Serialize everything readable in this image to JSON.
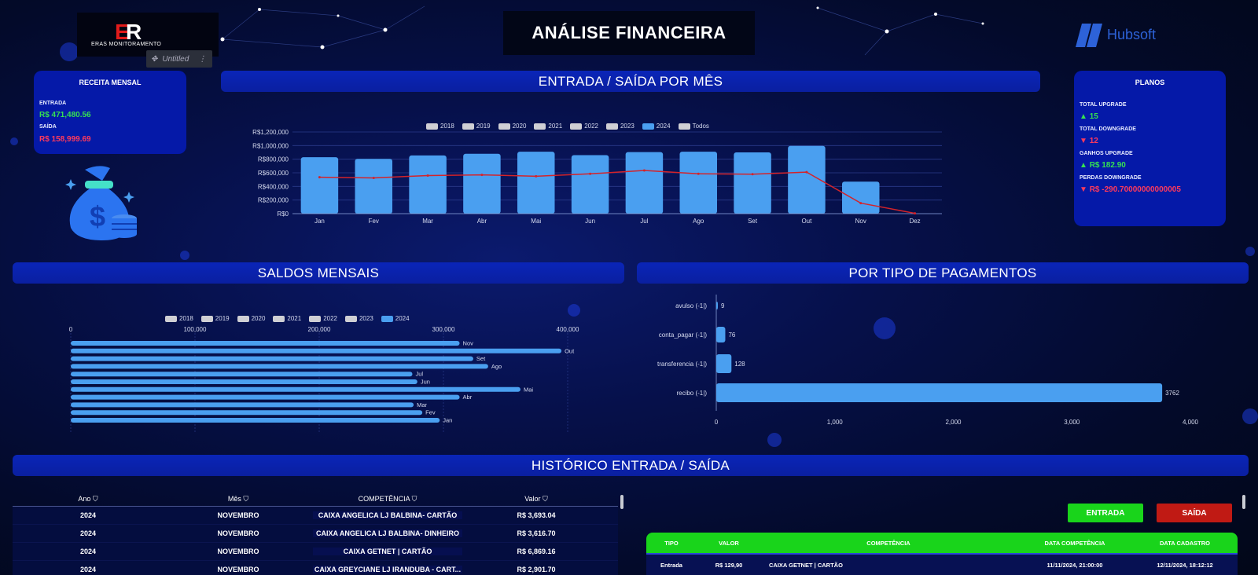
{
  "header": {
    "title": "ANÁLISE FINANCEIRA",
    "logo_left_text": "ERAS MONITORAMENTO",
    "logo_right_text": "Hubsoft",
    "untitled_label": "Untitled"
  },
  "receita": {
    "title": "RECEITA MENSAL",
    "entrada_label": "ENTRADA",
    "entrada_value": "R$ 471,480.56",
    "saida_label": "SAÍDA",
    "saida_value": "R$ 158,999.69"
  },
  "planos": {
    "title": "PLANOS",
    "upgrade_label": "TOTAL UPGRADE",
    "upgrade_value": "15",
    "downgrade_label": "TOTAL DOWNGRADE",
    "downgrade_value": "12",
    "ganhos_label": "GANHOS UPGRADE",
    "ganhos_value": "R$ 182.90",
    "perdas_label": "PERDAS DOWNGRADE",
    "perdas_value": "R$ -290.70000000000005"
  },
  "sections": {
    "entrada_saida": "ENTRADA / SAÍDA POR MÊS",
    "saldos": "SALDOS MENSAIS",
    "pagamentos": "POR TIPO DE PAGAMENTOS",
    "historico": "HISTÓRICO ENTRADA / SAÍDA"
  },
  "legend_top": [
    "2018",
    "2019",
    "2020",
    "2021",
    "2022",
    "2023",
    "2024",
    "Todos"
  ],
  "legend_top_active": "2024",
  "legend_saldos": [
    "2018",
    "2019",
    "2020",
    "2021",
    "2022",
    "2023",
    "2024"
  ],
  "legend_saldos_active": "2024",
  "colors": {
    "bar": "#4a9ff0",
    "line": "#d4232a",
    "green": "#19d41b",
    "red": "#c01a14"
  },
  "chart_data": [
    {
      "type": "bar",
      "title": "ENTRADA / SAÍDA POR MÊS",
      "categories": [
        "Jan",
        "Fev",
        "Mar",
        "Abr",
        "Mai",
        "Jun",
        "Jul",
        "Ago",
        "Set",
        "Out",
        "Nov",
        "Dez"
      ],
      "series": [
        {
          "values": [
            830000,
            805000,
            855000,
            880000,
            910000,
            860000,
            905000,
            910000,
            900000,
            995000,
            470000,
            0
          ]
        },
        {
          "type": "line",
          "values": [
            535000,
            525000,
            560000,
            570000,
            550000,
            585000,
            635000,
            585000,
            580000,
            610000,
            155000,
            5000
          ]
        }
      ],
      "y_ticks": [
        "R$0",
        "R$200,000",
        "R$400,000",
        "R$600,000",
        "R$800,000",
        "R$1,000,000",
        "R$1,200,000"
      ],
      "ylim": [
        0,
        1200000
      ],
      "grid": true,
      "legend": "top"
    },
    {
      "type": "bar",
      "orientation": "horizontal",
      "title": "SALDOS MENSAIS",
      "categories": [
        "Nov",
        "Out",
        "Set",
        "Ago",
        "Jul",
        "Jun",
        "Mai",
        "Abr",
        "Mar",
        "Fev",
        "Jan"
      ],
      "values": [
        313000,
        395000,
        324000,
        336000,
        275000,
        279000,
        362000,
        313000,
        276000,
        283000,
        297000
      ],
      "x_ticks": [
        "0",
        "100,000",
        "200,000",
        "300,000",
        "400,000"
      ],
      "xlim": [
        0,
        400000
      ],
      "legend": "top"
    },
    {
      "type": "bar",
      "orientation": "horizontal",
      "title": "POR TIPO DE PAGAMENTOS",
      "categories": [
        "avulso  (-1|)",
        "conta_pagar  (-1|)",
        "transferencia  (-1|)",
        "recibo  (-1|)"
      ],
      "values": [
        9,
        76,
        128,
        3762
      ],
      "x_ticks": [
        "0",
        "1,000",
        "2,000",
        "3,000",
        "4,000"
      ],
      "xlim": [
        0,
        4000
      ]
    }
  ],
  "historico_left": {
    "headers": [
      "Ano",
      "Mês",
      "COMPETÊNCIA",
      "Valor"
    ],
    "rows": [
      [
        "2024",
        "NOVEMBRO",
        "CAIXA ANGELICA LJ BALBINA- CARTÃO",
        "R$ 3,693.04"
      ],
      [
        "2024",
        "NOVEMBRO",
        "CAIXA ANGELICA LJ BALBINA- DINHEIRO",
        "R$ 3,616.70"
      ],
      [
        "2024",
        "NOVEMBRO",
        "CAIXA GETNET | CARTÃO",
        "R$ 6,869.16"
      ],
      [
        "2024",
        "NOVEMBRO",
        "CAIXA GREYCIANE LJ IRANDUBA - CART...",
        "R$ 2,901.70"
      ]
    ]
  },
  "buttons": {
    "entrada": "ENTRADA",
    "saida": "SAÍDA"
  },
  "historico_right": {
    "headers": [
      "TIPO",
      "VALOR",
      "COMPETÊNCIA",
      "DATA COMPETÊNCIA",
      "DATA CADASTRO"
    ],
    "rows": [
      [
        "Entrada",
        "R$ 129,90",
        "CAIXA GETNET | CARTÃO",
        "11/11/2024, 21:00:00",
        "12/11/2024, 18:12:12"
      ]
    ]
  }
}
